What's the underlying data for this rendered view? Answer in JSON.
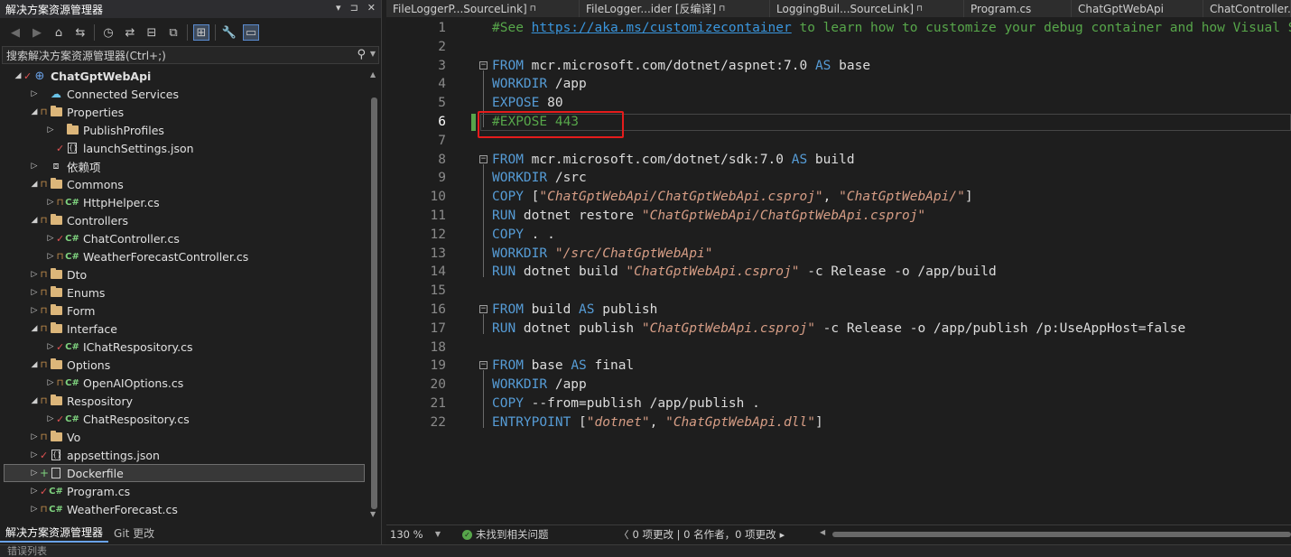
{
  "solution_explorer": {
    "title": "解决方案资源管理器",
    "title_buttons": [
      "▾",
      "⊐",
      "✕"
    ],
    "search_placeholder": "搜索解决方案资源管理器(Ctrl+;)",
    "tree": [
      {
        "label": "ChatGptWebApi",
        "depth": 0,
        "exp": "◢",
        "mark": "check",
        "icon": "project",
        "bold": true
      },
      {
        "label": "Connected Services",
        "depth": 1,
        "exp": "▷",
        "mark": "",
        "icon": "connected"
      },
      {
        "label": "Properties",
        "depth": 1,
        "exp": "◢",
        "mark": "lock",
        "icon": "properties"
      },
      {
        "label": "PublishProfiles",
        "depth": 2,
        "exp": "▷",
        "mark": "",
        "icon": "folder"
      },
      {
        "label": "launchSettings.json",
        "depth": 2,
        "exp": "",
        "mark": "check",
        "icon": "json"
      },
      {
        "label": "依赖项",
        "depth": 1,
        "exp": "▷",
        "mark": "",
        "icon": "deps"
      },
      {
        "label": "Commons",
        "depth": 1,
        "exp": "◢",
        "mark": "lock",
        "icon": "folder"
      },
      {
        "label": "HttpHelper.cs",
        "depth": 2,
        "exp": "▷",
        "mark": "lock",
        "icon": "cs"
      },
      {
        "label": "Controllers",
        "depth": 1,
        "exp": "◢",
        "mark": "lock",
        "icon": "folder"
      },
      {
        "label": "ChatController.cs",
        "depth": 2,
        "exp": "▷",
        "mark": "check",
        "icon": "cs"
      },
      {
        "label": "WeatherForecastController.cs",
        "depth": 2,
        "exp": "▷",
        "mark": "lock",
        "icon": "cs"
      },
      {
        "label": "Dto",
        "depth": 1,
        "exp": "▷",
        "mark": "lock",
        "icon": "folder"
      },
      {
        "label": "Enums",
        "depth": 1,
        "exp": "▷",
        "mark": "lock",
        "icon": "folder"
      },
      {
        "label": "Form",
        "depth": 1,
        "exp": "▷",
        "mark": "lock",
        "icon": "folder"
      },
      {
        "label": "Interface",
        "depth": 1,
        "exp": "◢",
        "mark": "lock",
        "icon": "folder"
      },
      {
        "label": "IChatRespository.cs",
        "depth": 2,
        "exp": "▷",
        "mark": "check",
        "icon": "cs"
      },
      {
        "label": "Options",
        "depth": 1,
        "exp": "◢",
        "mark": "lock",
        "icon": "folder"
      },
      {
        "label": "OpenAIOptions.cs",
        "depth": 2,
        "exp": "▷",
        "mark": "lock",
        "icon": "cs"
      },
      {
        "label": "Respository",
        "depth": 1,
        "exp": "◢",
        "mark": "lock",
        "icon": "folder"
      },
      {
        "label": "ChatRespository.cs",
        "depth": 2,
        "exp": "▷",
        "mark": "check",
        "icon": "cs"
      },
      {
        "label": "Vo",
        "depth": 1,
        "exp": "▷",
        "mark": "lock",
        "icon": "folder"
      },
      {
        "label": "appsettings.json",
        "depth": 1,
        "exp": "▷",
        "mark": "check",
        "icon": "json"
      },
      {
        "label": "Dockerfile",
        "depth": 1,
        "exp": "▷",
        "mark": "plus",
        "icon": "file",
        "selected": true
      },
      {
        "label": "Program.cs",
        "depth": 1,
        "exp": "▷",
        "mark": "check",
        "icon": "cs"
      },
      {
        "label": "WeatherForecast.cs",
        "depth": 1,
        "exp": "▷",
        "mark": "lock",
        "icon": "cs"
      }
    ],
    "bottom_tabs": [
      "解决方案资源管理器",
      "Git 更改"
    ],
    "bottom_strip": "错误列表"
  },
  "editor": {
    "tabs": [
      {
        "label": "FileLoggerP...SourceLink]",
        "locked": true
      },
      {
        "label": "FileLogger...ider [反编译]",
        "locked": true
      },
      {
        "label": "LoggingBuil...SourceLink]",
        "locked": true
      },
      {
        "label": "Program.cs",
        "locked": false
      },
      {
        "label": "ChatGptWebApi",
        "locked": false
      },
      {
        "label": "ChatController.cs",
        "locked": false
      }
    ],
    "current_line": 6,
    "lines": [
      {
        "n": "1",
        "fold": "",
        "segs": [
          [
            "c",
            "#See "
          ],
          [
            "u",
            "https://aka.ms/customizecontainer"
          ],
          [
            "c",
            " to learn how to customize your debug container and how Visual Studio uses this Dockerfile to build your images for faster debugging."
          ]
        ]
      },
      {
        "n": "2",
        "fold": "",
        "segs": []
      },
      {
        "n": "3",
        "fold": "−",
        "segs": [
          [
            "k",
            "FROM"
          ],
          [
            "p",
            " mcr.microsoft.com/dotnet/aspnet:7.0 "
          ],
          [
            "k",
            "AS"
          ],
          [
            "p",
            " base"
          ]
        ]
      },
      {
        "n": "4",
        "fold": "",
        "segs": [
          [
            "k",
            "WORKDIR"
          ],
          [
            "p",
            " /app"
          ]
        ]
      },
      {
        "n": "5",
        "fold": "",
        "segs": [
          [
            "k",
            "EXPOSE"
          ],
          [
            "p",
            " 80"
          ]
        ]
      },
      {
        "n": "6",
        "fold": "",
        "segs": [
          [
            "c",
            "#EXPOSE 443"
          ]
        ]
      },
      {
        "n": "7",
        "fold": "",
        "segs": []
      },
      {
        "n": "8",
        "fold": "−",
        "segs": [
          [
            "k",
            "FROM"
          ],
          [
            "p",
            " mcr.microsoft.com/dotnet/sdk:7.0 "
          ],
          [
            "k",
            "AS"
          ],
          [
            "p",
            " build"
          ]
        ]
      },
      {
        "n": "9",
        "fold": "",
        "segs": [
          [
            "k",
            "WORKDIR"
          ],
          [
            "p",
            " /src"
          ]
        ]
      },
      {
        "n": "10",
        "fold": "",
        "segs": [
          [
            "k",
            "COPY"
          ],
          [
            "p",
            " ["
          ],
          [
            "s",
            "\"ChatGptWebApi/ChatGptWebApi.csproj\""
          ],
          [
            "p",
            ", "
          ],
          [
            "s",
            "\"ChatGptWebApi/\""
          ],
          [
            "p",
            "]"
          ]
        ]
      },
      {
        "n": "11",
        "fold": "",
        "segs": [
          [
            "k",
            "RUN"
          ],
          [
            "p",
            " dotnet restore "
          ],
          [
            "s",
            "\"ChatGptWebApi/ChatGptWebApi.csproj\""
          ]
        ]
      },
      {
        "n": "12",
        "fold": "",
        "segs": [
          [
            "k",
            "COPY"
          ],
          [
            "p",
            " . ."
          ]
        ]
      },
      {
        "n": "13",
        "fold": "",
        "segs": [
          [
            "k",
            "WORKDIR"
          ],
          [
            "p",
            " "
          ],
          [
            "s",
            "\"/src/ChatGptWebApi\""
          ]
        ]
      },
      {
        "n": "14",
        "fold": "",
        "segs": [
          [
            "k",
            "RUN"
          ],
          [
            "p",
            " dotnet build "
          ],
          [
            "s",
            "\"ChatGptWebApi.csproj\""
          ],
          [
            "p",
            " -c Release -o /app/build"
          ]
        ]
      },
      {
        "n": "15",
        "fold": "",
        "segs": []
      },
      {
        "n": "16",
        "fold": "−",
        "segs": [
          [
            "k",
            "FROM"
          ],
          [
            "p",
            " build "
          ],
          [
            "k",
            "AS"
          ],
          [
            "p",
            " publish"
          ]
        ]
      },
      {
        "n": "17",
        "fold": "",
        "segs": [
          [
            "k",
            "RUN"
          ],
          [
            "p",
            " dotnet publish "
          ],
          [
            "s",
            "\"ChatGptWebApi.csproj\""
          ],
          [
            "p",
            " -c Release -o /app/publish /p:UseAppHost=false"
          ]
        ]
      },
      {
        "n": "18",
        "fold": "",
        "segs": []
      },
      {
        "n": "19",
        "fold": "−",
        "segs": [
          [
            "k",
            "FROM"
          ],
          [
            "p",
            " base "
          ],
          [
            "k",
            "AS"
          ],
          [
            "p",
            " final"
          ]
        ]
      },
      {
        "n": "20",
        "fold": "",
        "segs": [
          [
            "k",
            "WORKDIR"
          ],
          [
            "p",
            " /app"
          ]
        ]
      },
      {
        "n": "21",
        "fold": "",
        "segs": [
          [
            "k",
            "COPY"
          ],
          [
            "p",
            " --from=publish /app/publish ."
          ]
        ]
      },
      {
        "n": "22",
        "fold": "",
        "segs": [
          [
            "k",
            "ENTRYPOINT"
          ],
          [
            "p",
            " ["
          ],
          [
            "s",
            "\"dotnet\""
          ],
          [
            "p",
            ", "
          ],
          [
            "s",
            "\"ChatGptWebApi.dll\""
          ],
          [
            "p",
            "]"
          ]
        ]
      }
    ],
    "status": {
      "zoom": "130 %",
      "issues": "未找到相关问题",
      "changes": "0 项更改 | 0 名作者，0 项更改"
    }
  },
  "colors": {
    "accent": "#6aa2e8",
    "highlight": "#e51c1c",
    "keyword": "#569cd6",
    "string": "#d69d85",
    "comment": "#57a64a"
  }
}
